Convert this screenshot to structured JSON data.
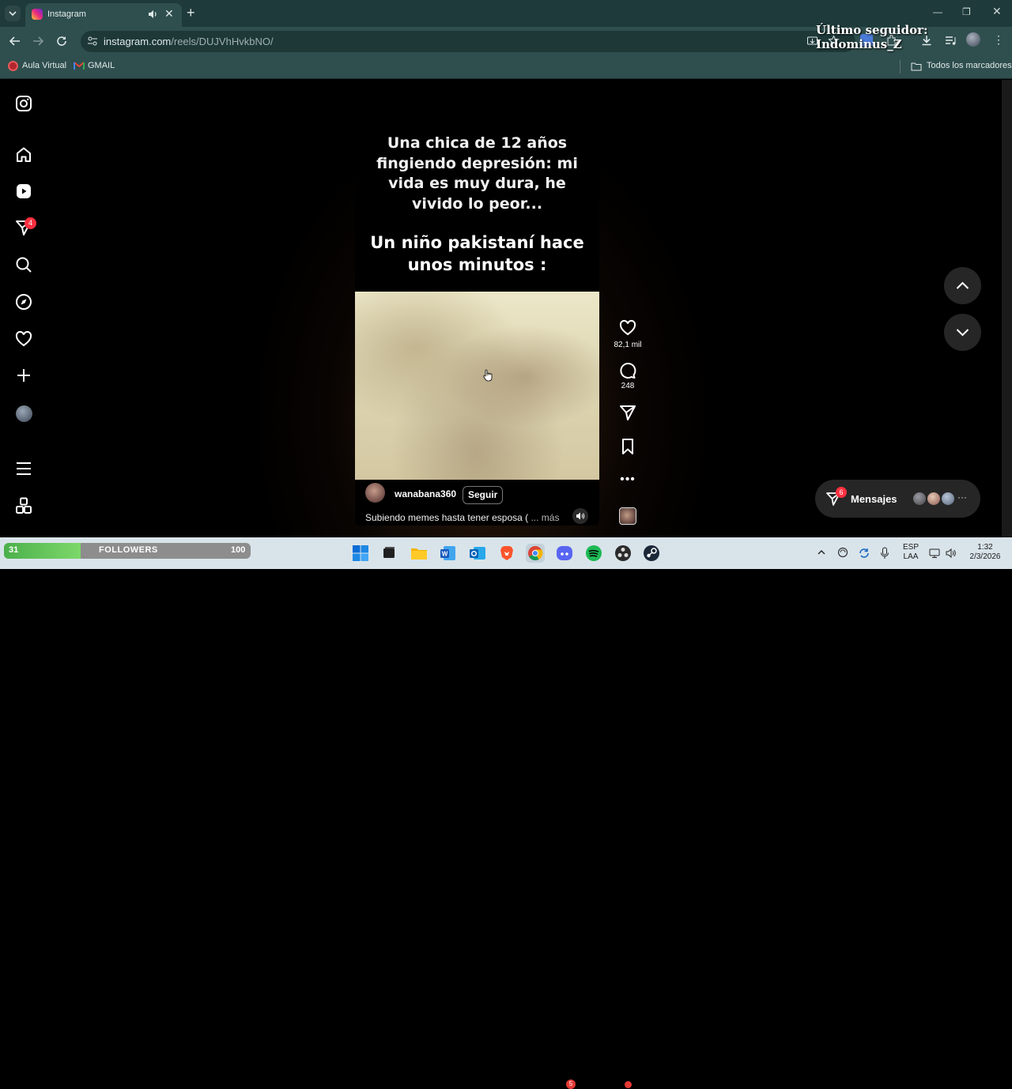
{
  "browser": {
    "tab_title": "Instagram",
    "url_host": "instagram.com",
    "url_path": "/reels/DUJVhHvkbNO/",
    "bookmarks": [
      {
        "label": "Aula Virtual"
      },
      {
        "label": "GMAIL"
      }
    ],
    "all_bookmarks": "Todos los marcadores"
  },
  "overlay_text": "Último seguidor: Indominus_Z",
  "sidebar": {
    "notifications_badge": "4"
  },
  "reel": {
    "caption_top": "Una chica de 12 años fingiendo depresión: mi vida es muy dura, he vivido lo peor...",
    "caption_bottom": "Un niño pakistaní hace unos minutos :",
    "username": "wanabana360",
    "follow_label": "Seguir",
    "description": "Subiendo memes hasta tener esposa ( ",
    "more_label": "... más",
    "likes": "82,1 mil",
    "comments": "248"
  },
  "messages": {
    "label": "Mensajes",
    "badge": "6"
  },
  "taskbar": {
    "followers_label": "FOLLOWERS",
    "followers_current": "31",
    "followers_goal": "100",
    "followers_progress": 0.31,
    "discord_badge": "5",
    "lang_line1": "ESP",
    "lang_line2": "LAA",
    "time": "1:32",
    "date": "2/3/2026"
  },
  "colors": {
    "chrome_frame": "#1f3a3a",
    "chrome_toolbar": "#2f4e4e",
    "badge_red": "#ff3040",
    "taskbar": "#d9e4ea"
  }
}
